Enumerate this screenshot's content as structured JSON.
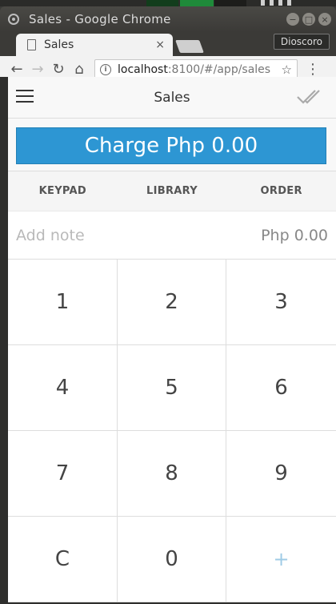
{
  "browser": {
    "window_title": "Sales - Google Chrome",
    "tab_title": "Sales",
    "tab_close": "×",
    "profile_name": "Dioscoro",
    "url_host": "localhost",
    "url_rest": ":8100/#/app/sales",
    "window_controls": [
      "−",
      "□",
      "×"
    ]
  },
  "app": {
    "header_title": "Sales",
    "charge_label": "Charge Php 0.00",
    "tabs": [
      "KEYPAD",
      "LIBRARY",
      "ORDER"
    ],
    "note_placeholder": "Add note",
    "note_amount": "Php 0.00",
    "keys": [
      "1",
      "2",
      "3",
      "4",
      "5",
      "6",
      "7",
      "8",
      "9",
      "C",
      "0",
      "+"
    ]
  },
  "colors": {
    "charge_button": "#2d96d3",
    "plus_key": "#9fcbe6"
  },
  "icons": {
    "menu": "hamburger-icon",
    "done": "double-check-icon",
    "back": "back-arrow-icon",
    "forward": "forward-arrow-icon",
    "reload": "reload-icon",
    "home": "home-icon",
    "info": "info-icon",
    "bookmark": "star-icon",
    "browser_menu": "kebab-menu-icon"
  }
}
